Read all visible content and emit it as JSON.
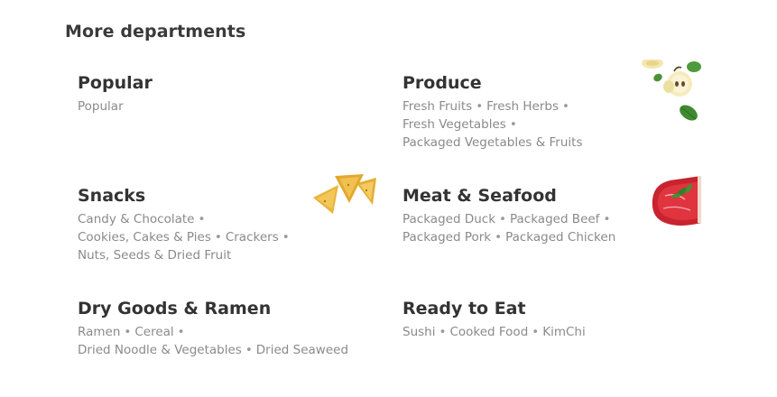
{
  "section": {
    "title": "More departments"
  },
  "departments": [
    {
      "name": "Popular",
      "links": [
        "Popular"
      ]
    },
    {
      "name": "Produce",
      "links": [
        "Fresh Fruits",
        "Fresh Herbs",
        "Fresh Vegetables",
        "Packaged Vegetables & Fruits"
      ]
    },
    {
      "name": "Snacks",
      "links": [
        "Candy & Chocolate",
        "Cookies, Cakes & Pies",
        "Crackers",
        "Nuts, Seeds & Dried Fruit"
      ]
    },
    {
      "name": "Meat & Seafood",
      "links": [
        "Packaged Duck",
        "Packaged Beef",
        "Packaged Pork",
        "Packaged Chicken"
      ]
    },
    {
      "name": "Dry Goods & Ramen",
      "links": [
        "Ramen",
        "Cereal",
        "Dried Noodle & Vegetables",
        "Dried Seaweed"
      ]
    },
    {
      "name": "Ready to Eat",
      "links": [
        "Sushi",
        "Cooked Food",
        "KimChi"
      ]
    }
  ],
  "separator": "•"
}
